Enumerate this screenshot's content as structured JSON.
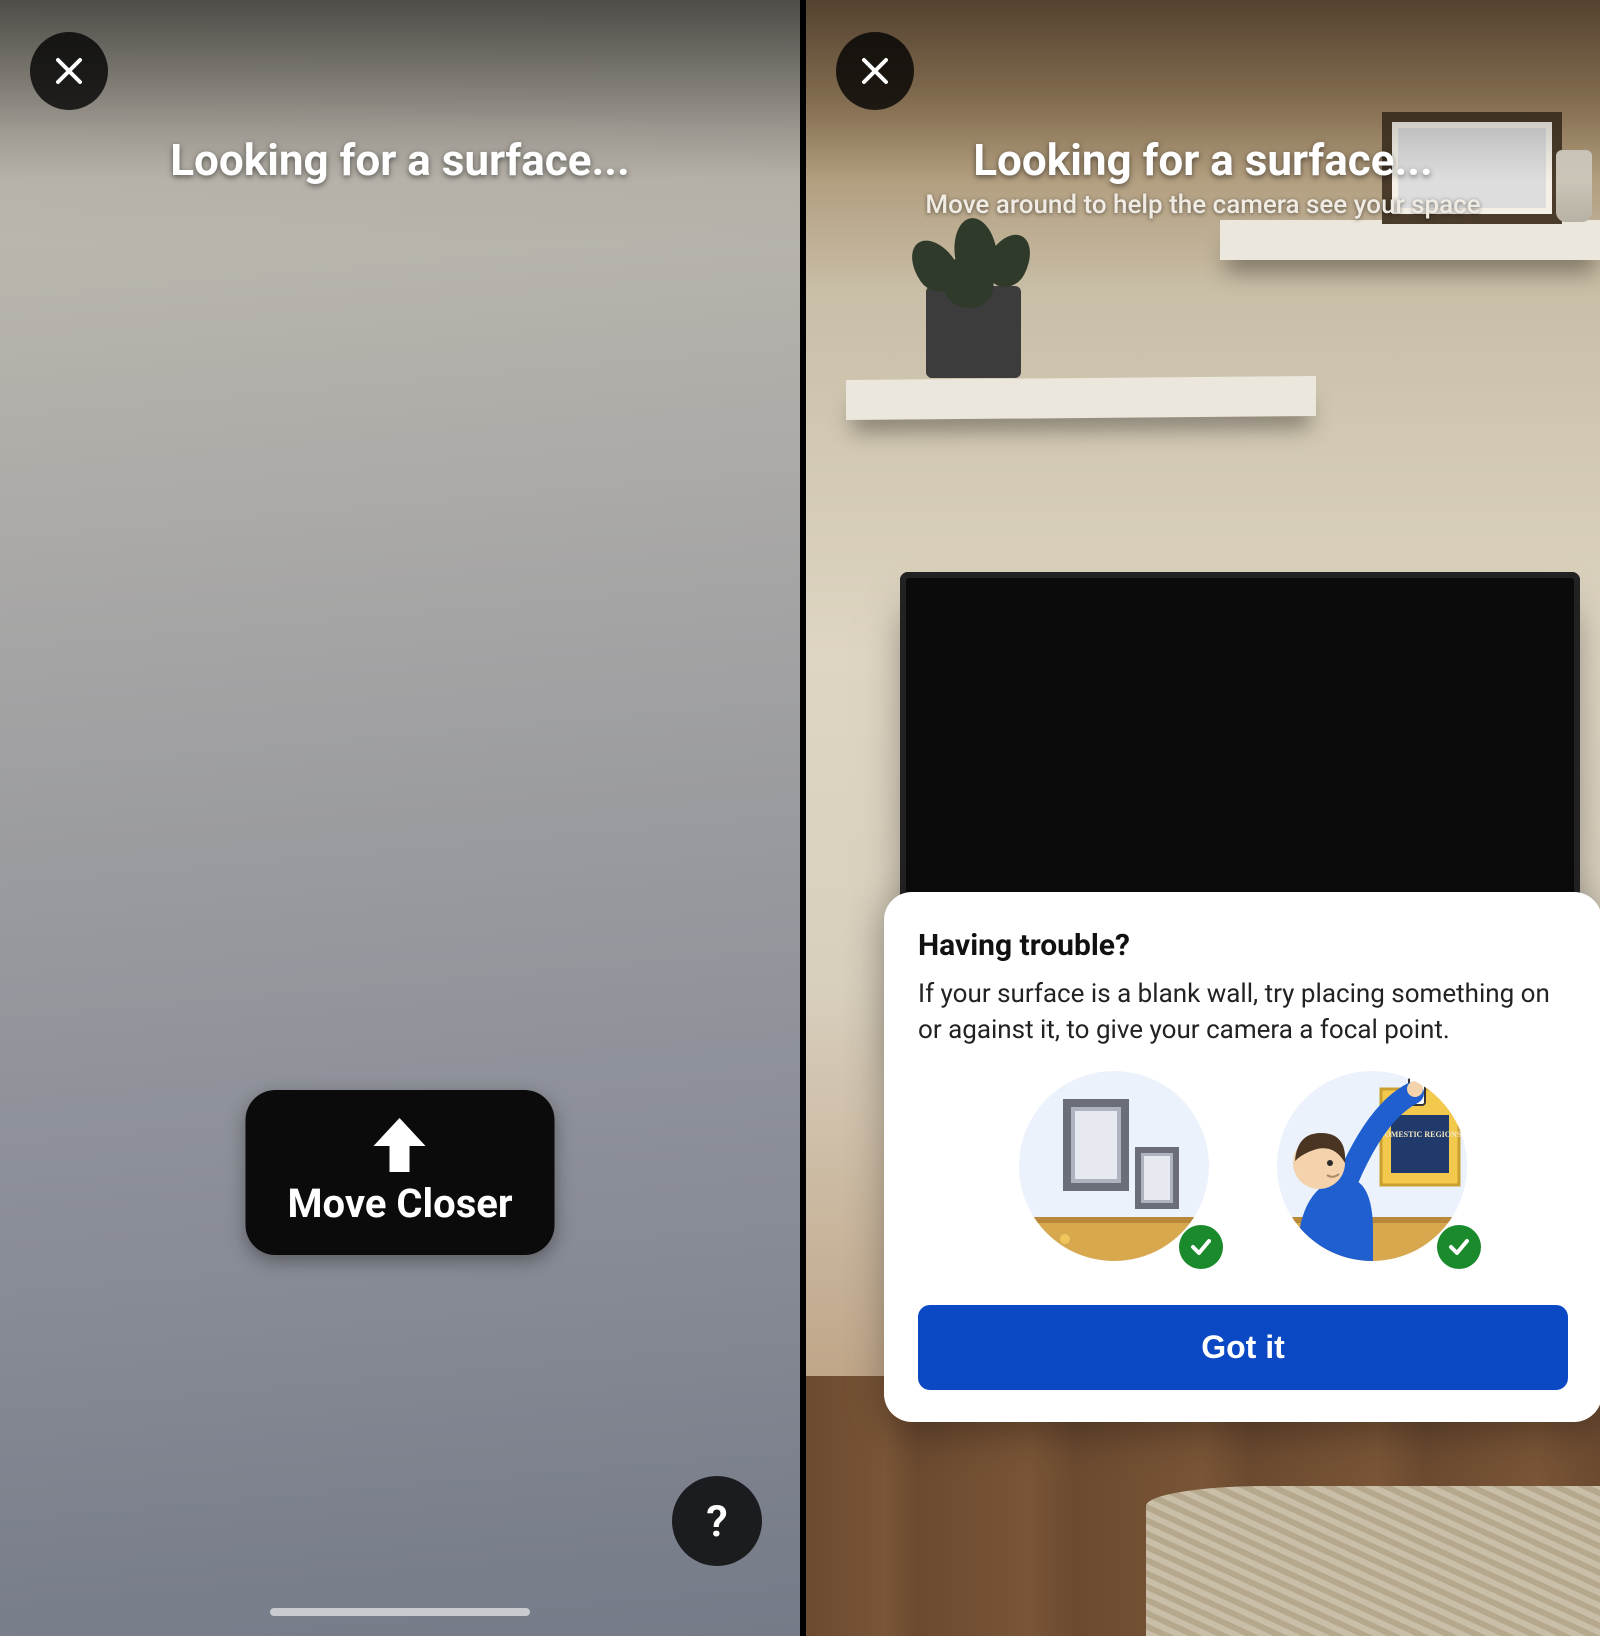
{
  "left": {
    "title": "Looking for a surface...",
    "move_closer_label": "Move Closer",
    "help_glyph": "?"
  },
  "right": {
    "title": "Looking for a surface...",
    "subtitle": "Move around to help the camera see your space",
    "help_card": {
      "heading": "Having trouble?",
      "body": "If your surface is a blank wall, try placing something on or against it, to give your camera a focal point.",
      "illustration_poster_text": "DOMESTIC REGIONS",
      "cta_label": "Got it"
    }
  }
}
